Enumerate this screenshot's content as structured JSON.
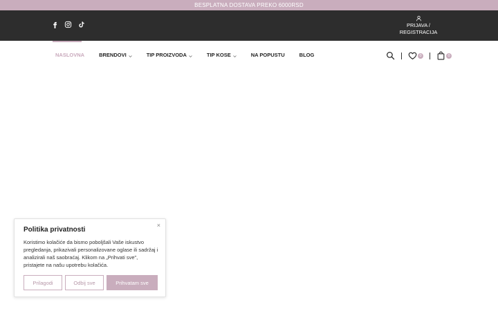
{
  "promo": {
    "text": "BESPLATNA DOSTAVA PREKO 6000RSD"
  },
  "social": {
    "icons": [
      "facebook-icon",
      "instagram-icon",
      "tiktok-icon"
    ]
  },
  "account": {
    "line1": "PRIJAVA /",
    "line2": "REGISTRACIJA"
  },
  "nav": {
    "items": [
      {
        "label": "NASLOVNA",
        "active": true,
        "dropdown": false
      },
      {
        "label": "BRENDOVI",
        "active": false,
        "dropdown": true
      },
      {
        "label": "TIP PROIZVODA",
        "active": false,
        "dropdown": true
      },
      {
        "label": "TIP KOSE",
        "active": false,
        "dropdown": true
      },
      {
        "label": "NA POPUSTU",
        "active": false,
        "dropdown": false
      },
      {
        "label": "BLOG",
        "active": false,
        "dropdown": false
      }
    ]
  },
  "header_icons": {
    "wishlist_count": "0",
    "cart_count": "0"
  },
  "cookie": {
    "title": "Politika privatnosti",
    "text": "Koristimo kolačiće da bismo poboljšali Vaše iskustvo pregledanja, prikazivali personalizovane oglase ili sadržaj i analizirali naš saobraćaj. Klikom na „Prihvati sve\", pristajete na našu upotrebu kolačića.",
    "close": "×",
    "btn_customize": "Prilagodi",
    "btn_reject": "Odbij sve",
    "btn_accept": "Prihvatam sve"
  },
  "colors": {
    "accent": "#c9adbd",
    "topbar": "#2d2d2d"
  }
}
